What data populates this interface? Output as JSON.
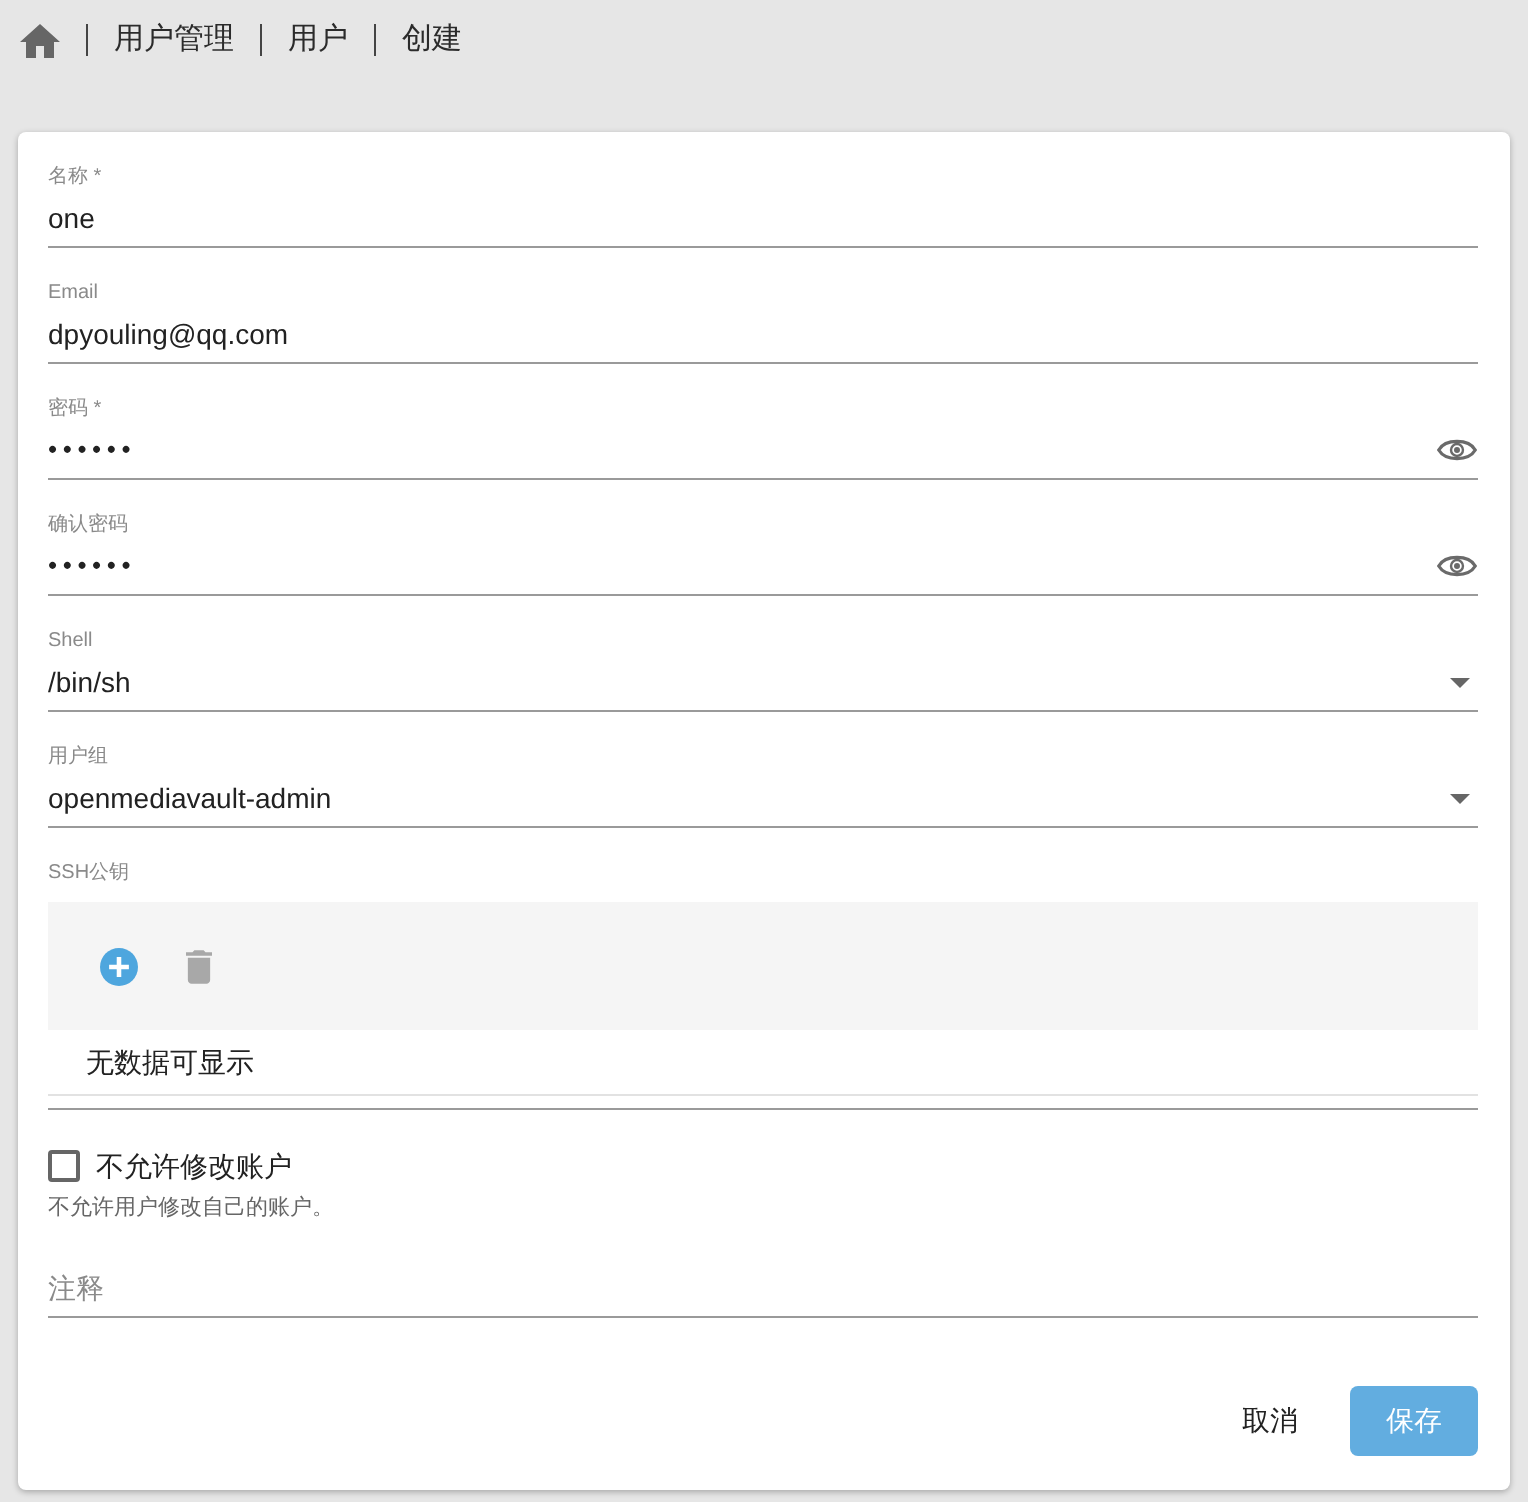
{
  "breadcrumb": {
    "items": [
      "用户管理",
      "用户",
      "创建"
    ]
  },
  "form": {
    "fields": [
      {
        "kind": "text",
        "label": "名称 *",
        "value": "one"
      },
      {
        "kind": "text",
        "label": "Email",
        "value": "dpyouling@qq.com"
      },
      {
        "kind": "password",
        "label": "密码 *",
        "value": "••••••"
      },
      {
        "kind": "password",
        "label": "确认密码",
        "value": "••••••"
      },
      {
        "kind": "select",
        "label": "Shell",
        "value": "/bin/sh"
      },
      {
        "kind": "select",
        "label": "用户组",
        "value": "openmediavault-admin"
      }
    ],
    "ssh_keys": {
      "label": "SSH公钥",
      "tools": [
        {
          "kind": "add",
          "disabled": false
        },
        {
          "kind": "delete",
          "disabled": true
        }
      ],
      "empty_message": "无数据可显示"
    },
    "checkbox": {
      "label": "不允许修改账户",
      "checked": false,
      "hint": "不允许用户修改自己的账户。"
    },
    "comment": {
      "placeholder": "注释"
    },
    "buttons": [
      {
        "kind": "cancel",
        "label": "取消"
      },
      {
        "kind": "submit",
        "label": "保存"
      }
    ]
  }
}
